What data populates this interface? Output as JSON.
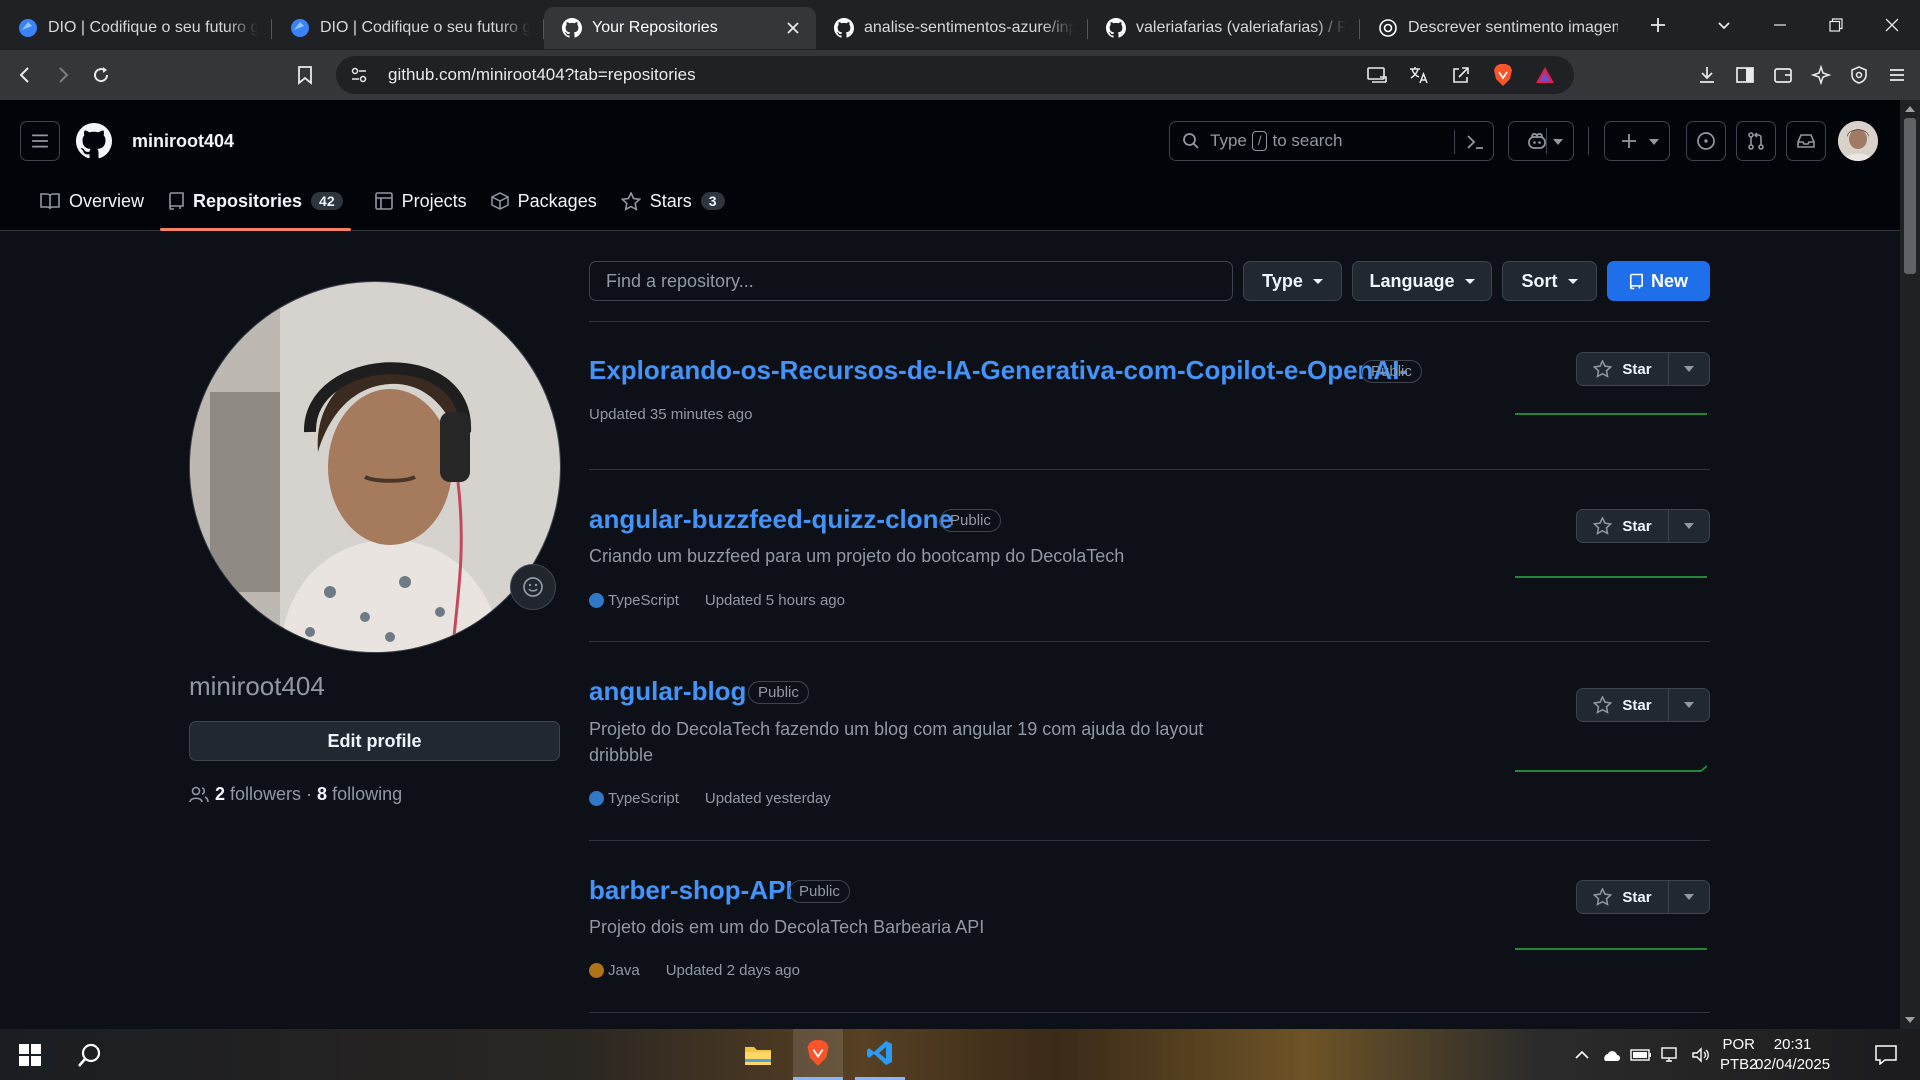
{
  "browser": {
    "tabs": [
      {
        "title": "DIO | Codifique o seu futuro gl",
        "favicon": "dio-icon",
        "active": false
      },
      {
        "title": "DIO | Codifique o seu futuro gl",
        "favicon": "dio-icon",
        "active": false
      },
      {
        "title": "Your Repositories",
        "favicon": "github-icon",
        "active": true
      },
      {
        "title": "analise-sentimentos-azure/inpu",
        "favicon": "github-icon",
        "active": false
      },
      {
        "title": "valeriafarias (valeriafarias) / Rep",
        "favicon": "github-icon",
        "active": false
      },
      {
        "title": "Descrever sentimento imagem",
        "favicon": "chatgpt-icon",
        "active": false
      }
    ],
    "url": "github.com/miniroot404?tab=repositories"
  },
  "github": {
    "username": "miniroot404",
    "search_placeholder_pre": "Type",
    "search_key": "/",
    "search_placeholder_post": "to search",
    "nav": [
      {
        "label": "Overview",
        "icon": "book-icon"
      },
      {
        "label": "Repositories",
        "count": "42",
        "icon": "repo-icon"
      },
      {
        "label": "Projects",
        "icon": "table-icon"
      },
      {
        "label": "Packages",
        "icon": "package-icon"
      },
      {
        "label": "Stars",
        "count": "3",
        "icon": "star-icon"
      }
    ]
  },
  "profile": {
    "name": "miniroot404",
    "edit_label": "Edit profile",
    "followers": "2",
    "followers_label": "followers",
    "separator": "·",
    "following": "8",
    "following_label": "following"
  },
  "filters": {
    "find_placeholder": "Find a repository...",
    "type_label": "Type",
    "language_label": "Language",
    "sort_label": "Sort",
    "new_label": "New"
  },
  "repos": [
    {
      "name": "Explorando-os-Recursos-de-IA-Generativa-com-Copilot-e-OpenAI-",
      "visibility": "Public",
      "description": "",
      "language": "",
      "updated": "Updated 35 minutes ago"
    },
    {
      "name": "angular-buzzfeed-quizz-clone",
      "visibility": "Public",
      "description": "Criando um buzzfeed para um projeto do bootcamp do DecolaTech",
      "language": "TypeScript",
      "language_color": "#3178c6",
      "updated": "Updated 5 hours ago"
    },
    {
      "name": "angular-blog",
      "visibility": "Public",
      "description": "Projeto do DecolaTech fazendo um blog com angular 19 com ajuda do layout dribbble",
      "language": "TypeScript",
      "language_color": "#3178c6",
      "updated": "Updated yesterday"
    },
    {
      "name": "barber-shop-API",
      "visibility": "Public",
      "description": "Projeto dois em um do DecolaTech Barbearia API",
      "language": "Java",
      "language_color": "#b07219",
      "updated": "Updated 2 days ago"
    }
  ],
  "star_label": "Star",
  "taskbar": {
    "lang_line1": "POR",
    "lang_line2": "PTB2",
    "time": "20:31",
    "date": "02/04/2025"
  },
  "colors": {
    "accent": "#1f6feb",
    "link": "#4493f8",
    "tab_underline": "#f78166",
    "spark": "#238636"
  }
}
